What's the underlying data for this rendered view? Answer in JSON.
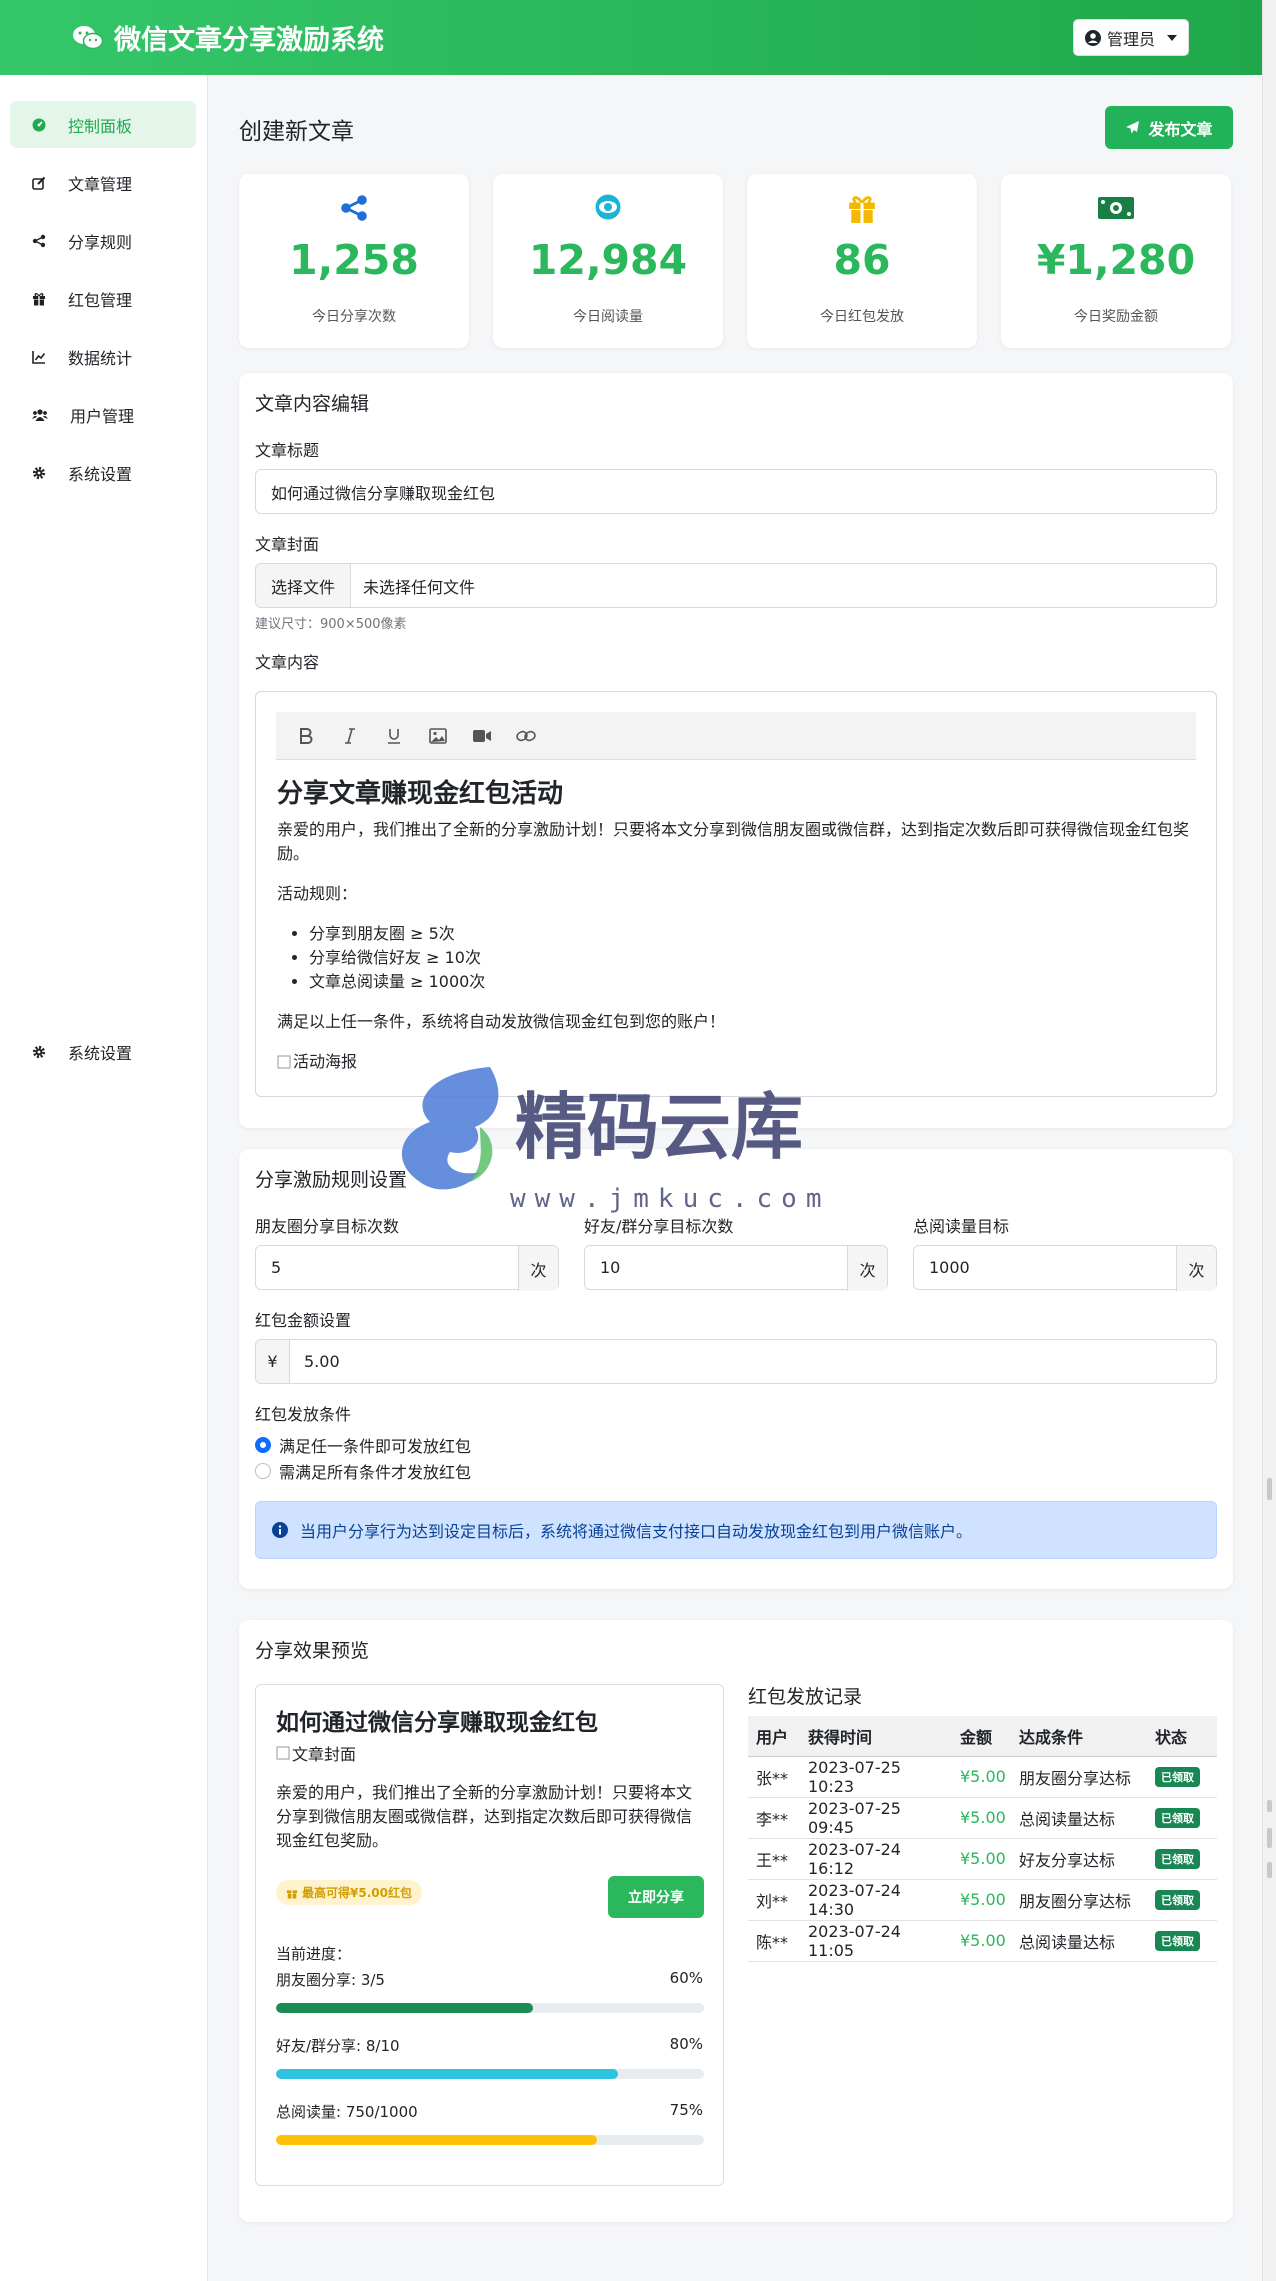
{
  "header": {
    "title": "微信文章分享激励系统",
    "admin_label": "管理员"
  },
  "sidebar": {
    "items": [
      {
        "label": "控制面板",
        "icon": "dashboard-icon",
        "active": true
      },
      {
        "label": "文章管理",
        "icon": "edit-icon"
      },
      {
        "label": "分享规则",
        "icon": "share-icon"
      },
      {
        "label": "红包管理",
        "icon": "gift-icon"
      },
      {
        "label": "数据统计",
        "icon": "chart-line-icon"
      },
      {
        "label": "用户管理",
        "icon": "users-icon"
      },
      {
        "label": "系统设置",
        "icon": "gear-icon"
      }
    ],
    "bottom_item": {
      "label": "系统设置",
      "icon": "gear-icon"
    }
  },
  "page": {
    "title": "创建新文章",
    "publish_label": "发布文章"
  },
  "stats": [
    {
      "value": "1,258",
      "label": "今日分享次数",
      "icon": "share-icon",
      "color": "#1e6fd9"
    },
    {
      "value": "12,984",
      "label": "今日阅读量",
      "icon": "eye-icon",
      "color": "#19b5d9"
    },
    {
      "value": "86",
      "label": "今日红包发放",
      "icon": "gift-icon",
      "color": "#f5b800"
    },
    {
      "value": "¥1,280",
      "label": "今日奖励金额",
      "icon": "money-icon",
      "color": "#1a7f45"
    }
  ],
  "editor_panel": {
    "title": "文章内容编辑",
    "title_label": "文章标题",
    "title_value": "如何通过微信分享赚取现金红包",
    "cover_label": "文章封面",
    "choose_file": "选择文件",
    "no_file": "未选择任何文件",
    "cover_hint": "建议尺寸：900×500像素",
    "content_label": "文章内容",
    "content": {
      "heading": "分享文章赚现金红包活动",
      "intro": "亲爱的用户，我们推出了全新的分享激励计划！只要将本文分享到微信朋友圈或微信群，达到指定次数后即可获得微信现金红包奖励。",
      "rules_title": "活动规则：",
      "rules": [
        "分享到朋友圈 ≥ 5次",
        "分享给微信好友 ≥ 10次",
        "文章总阅读量 ≥ 1000次"
      ],
      "footer": "满足以上任一条件，系统将自动发放微信现金红包到您的账户！",
      "image_alt": "活动海报"
    }
  },
  "rules_panel": {
    "title": "分享激励规则设置",
    "moments_label": "朋友圈分享目标次数",
    "moments_value": "5",
    "friends_label": "好友/群分享目标次数",
    "friends_value": "10",
    "reads_label": "总阅读量目标",
    "reads_value": "1000",
    "unit": "次",
    "amount_label": "红包金额设置",
    "currency": "¥",
    "amount_value": "5.00",
    "condition_label": "红包发放条件",
    "option_any": "满足任一条件即可发放红包",
    "option_all": "需满足所有条件才发放红包",
    "selected_option": "any",
    "info": "当用户分享行为达到设定目标后，系统将通过微信支付接口自动发放现金红包到用户微信账户。"
  },
  "preview_panel": {
    "title": "分享效果预览",
    "article_title": "如何通过微信分享赚取现金红包",
    "cover_alt": "文章封面",
    "intro": "亲爱的用户，我们推出了全新的分享激励计划！只要将本文分享到微信朋友圈或微信群，达到指定次数后即可获得微信现金红包奖励。",
    "max_badge": "最高可得¥5.00红包",
    "share_button": "立即分享",
    "progress_title": "当前进度：",
    "progress": [
      {
        "label": "朋友圈分享: 3/5",
        "percent_label": "60%",
        "fraction": 0.6,
        "color": "#1e8a55"
      },
      {
        "label": "好友/群分享: 8/10",
        "percent_label": "80%",
        "fraction": 0.8,
        "color": "#2dc2e0"
      },
      {
        "label": "总阅读量: 750/1000",
        "percent_label": "75%",
        "fraction": 0.75,
        "color": "#ffc107"
      }
    ],
    "records_title": "红包发放记录",
    "records_headers": [
      "用户",
      "获得时间",
      "金额",
      "达成条件",
      "状态"
    ],
    "records": [
      [
        "张**",
        "2023-07-25 10:23",
        "¥5.00",
        "朋友圈分享达标",
        "已领取"
      ],
      [
        "李**",
        "2023-07-25 09:45",
        "¥5.00",
        "总阅读量达标",
        "已领取"
      ],
      [
        "王**",
        "2023-07-24 16:12",
        "¥5.00",
        "好友分享达标",
        "已领取"
      ],
      [
        "刘**",
        "2023-07-24 14:30",
        "¥5.00",
        "朋友圈分享达标",
        "已领取"
      ],
      [
        "陈**",
        "2023-07-24 11:05",
        "¥5.00",
        "总阅读量达标",
        "已领取"
      ]
    ]
  },
  "watermark": {
    "text": "精码云库",
    "url": "www.jmkuc.com"
  }
}
